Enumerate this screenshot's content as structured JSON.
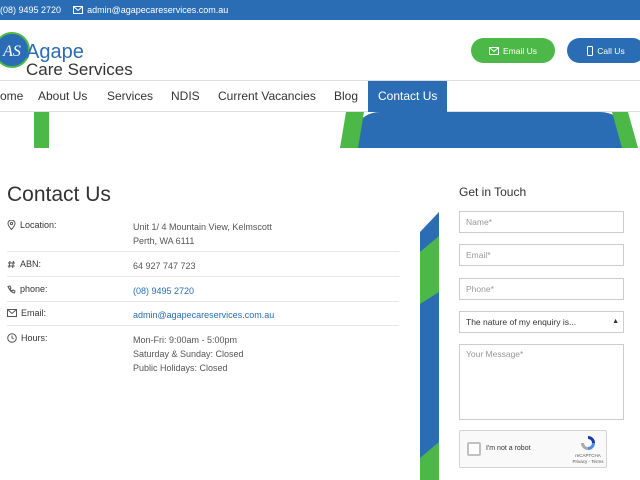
{
  "topbar": {
    "phone": "(08) 9495 2720",
    "email": "admin@agapecareservices.com.au"
  },
  "brand": {
    "name_line1": "Agape",
    "name_line2": "Care Services",
    "logo_letters": "AS",
    "primary_color": "#2a6db4",
    "accent_color": "#4cb848"
  },
  "header_buttons": {
    "email_label": "Email Us",
    "call_label": "Call Us"
  },
  "nav": {
    "items": [
      "ome",
      "About Us",
      "Services",
      "NDIS",
      "Current Vacancies",
      "Blog",
      "Contact Us"
    ],
    "active": "Contact Us"
  },
  "contact": {
    "title": "Contact Us",
    "location_label": "Location:",
    "location_line1": "Unit 1/ 4 Mountain View, Kelmscott",
    "location_line2": "Perth, WA 6111",
    "abn_label": "ABN:",
    "abn_value": "64 927 747 723",
    "phone_label": "phone:",
    "phone_value": "(08) 9495 2720",
    "email_label": "Email:",
    "email_value": "admin@agapecareservices.com.au",
    "hours_label": "Hours:",
    "hours_line1": "Mon-Fri: 9:00am - 5:00pm",
    "hours_line2": "Saturday & Sunday: Closed",
    "hours_line3": "Public Holidays: Closed"
  },
  "form": {
    "title": "Get in Touch",
    "name_placeholder": "Name*",
    "email_placeholder": "Email*",
    "phone_placeholder": "Phone*",
    "enquiry_selected": "The nature of my enquiry is...",
    "message_placeholder": "Your Message*",
    "recaptcha_label": "I'm not a robot",
    "recaptcha_brand": "reCAPTCHA",
    "recaptcha_links": "Privacy - Terms"
  }
}
